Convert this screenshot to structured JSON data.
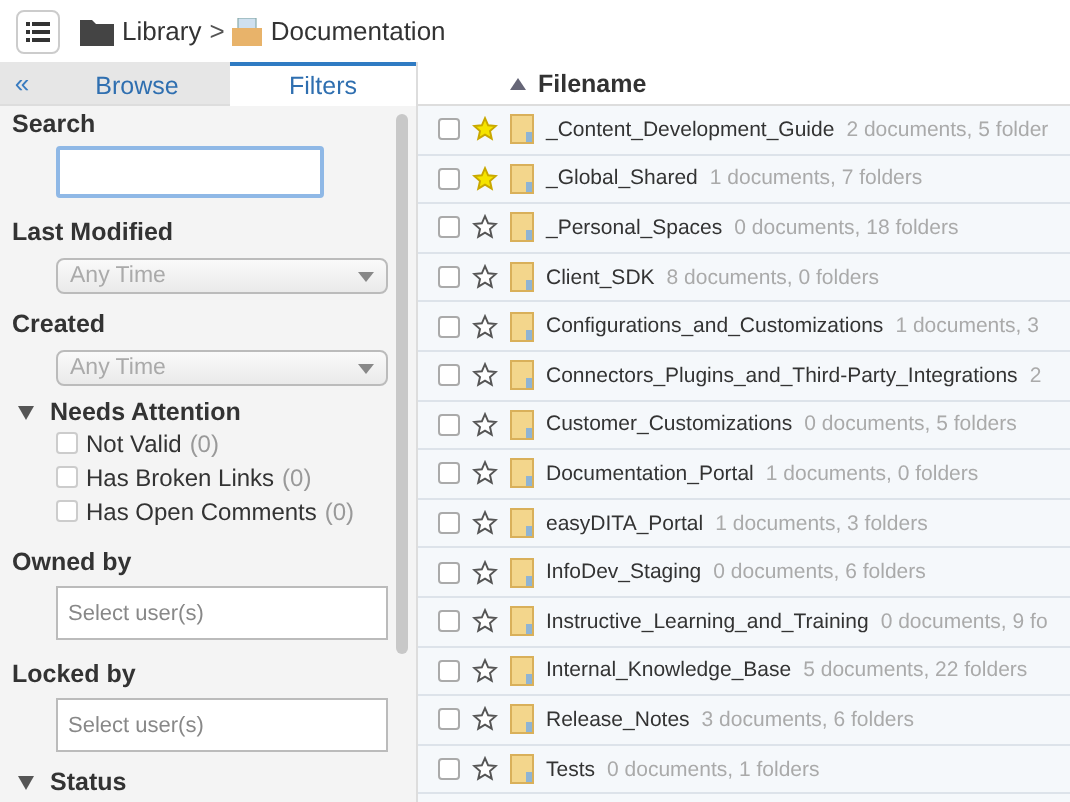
{
  "breadcrumb": {
    "items": [
      {
        "label": "Library"
      },
      {
        "label": "Documentation"
      }
    ],
    "separator": ">"
  },
  "sidebar": {
    "collapse": "«",
    "tabs": [
      {
        "label": "Browse",
        "selected": false
      },
      {
        "label": "Filters",
        "selected": true
      }
    ],
    "sections": [
      {
        "kind": "search",
        "title": "Search"
      },
      {
        "kind": "select",
        "title": "Last Modified",
        "value": "Any Time"
      },
      {
        "kind": "select",
        "title": "Created",
        "value": "Any Time"
      },
      {
        "kind": "checklist",
        "title": "Needs Attention",
        "expanded": true,
        "options": [
          {
            "label": "Not Valid",
            "count": "(0)",
            "checked": false
          },
          {
            "label": "Has Broken Links",
            "count": "(0)",
            "checked": false
          },
          {
            "label": "Has Open Comments",
            "count": "(0)",
            "checked": false
          }
        ]
      },
      {
        "kind": "users",
        "title": "Owned by",
        "placeholder": "Select user(s)"
      },
      {
        "kind": "users",
        "title": "Locked by",
        "placeholder": "Select user(s)"
      },
      {
        "kind": "checklist",
        "title": "Status",
        "expanded": true
      }
    ]
  },
  "table": {
    "column": "Filename",
    "rows": [
      {
        "name": "_Content_Development_Guide",
        "info": "2 documents, 5 folder",
        "starred": true,
        "checked": false
      },
      {
        "name": "_Global_Shared",
        "info": "1 documents, 7 folders",
        "starred": true,
        "checked": false
      },
      {
        "name": "_Personal_Spaces",
        "info": "0 documents, 18 folders",
        "starred": false,
        "checked": false
      },
      {
        "name": "Client_SDK",
        "info": "8 documents, 0 folders",
        "starred": false,
        "checked": false
      },
      {
        "name": "Configurations_and_Customizations",
        "info": "1 documents, 3",
        "starred": false,
        "checked": false
      },
      {
        "name": "Connectors_Plugins_and_Third-Party_Integrations",
        "info": "2",
        "starred": false,
        "checked": false
      },
      {
        "name": "Customer_Customizations",
        "info": "0 documents, 5 folders",
        "starred": false,
        "checked": false
      },
      {
        "name": "Documentation_Portal",
        "info": "1 documents, 0 folders",
        "starred": false,
        "checked": false
      },
      {
        "name": "easyDITA_Portal",
        "info": "1 documents, 3 folders",
        "starred": false,
        "checked": false
      },
      {
        "name": "InfoDev_Staging",
        "info": "0 documents, 6 folders",
        "starred": false,
        "checked": false
      },
      {
        "name": "Instructive_Learning_and_Training",
        "info": "0 documents, 9 fo",
        "starred": false,
        "checked": false
      },
      {
        "name": "Internal_Knowledge_Base",
        "info": "5 documents, 22 folders",
        "starred": false,
        "checked": false
      },
      {
        "name": "Release_Notes",
        "info": "3 documents, 6 folders",
        "starred": false,
        "checked": false
      },
      {
        "name": "Tests",
        "info": "0 documents, 1 folders",
        "starred": false,
        "checked": false
      }
    ]
  }
}
